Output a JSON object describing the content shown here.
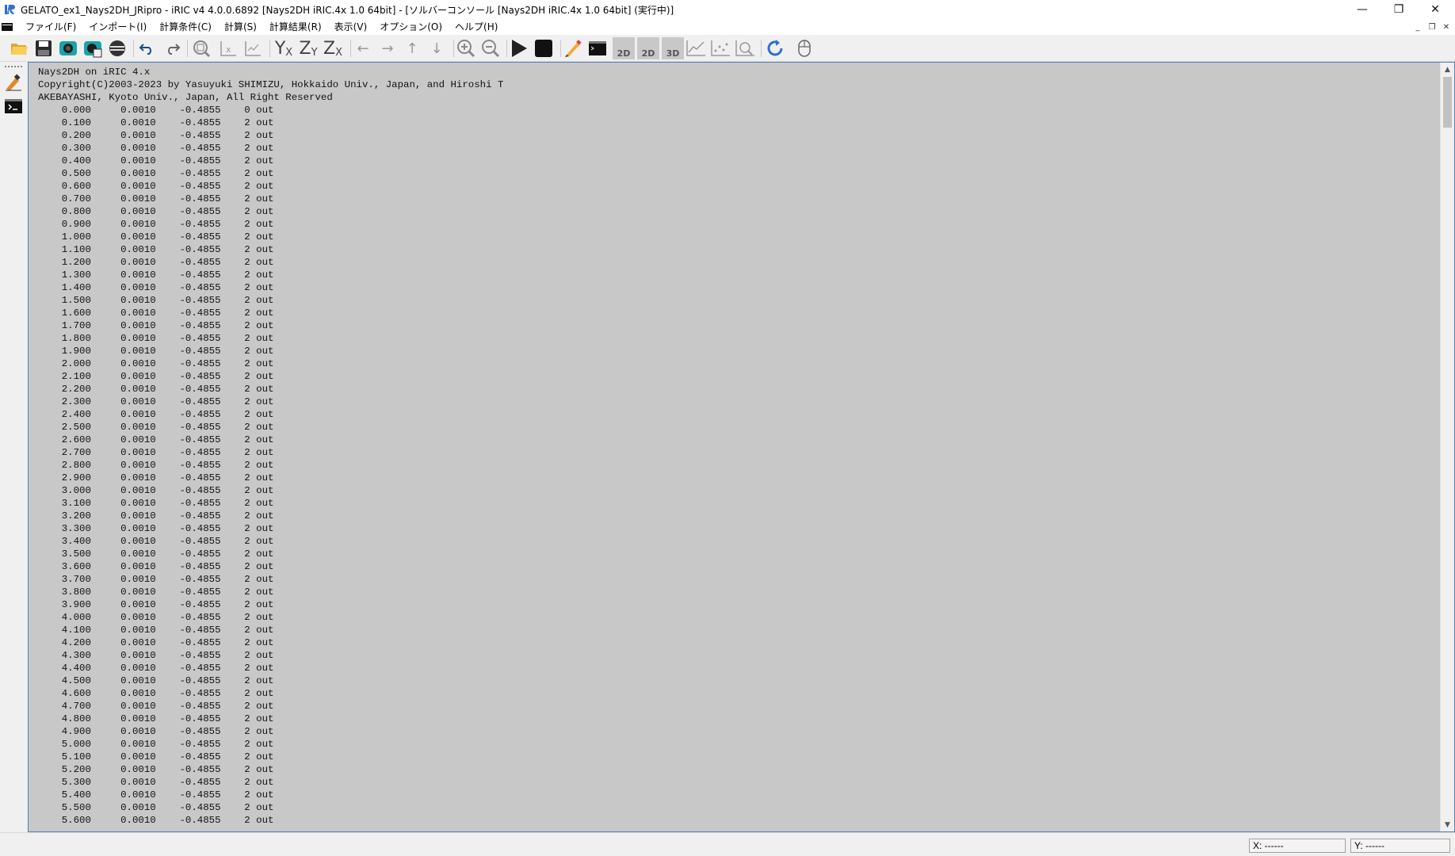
{
  "window": {
    "title": "GELATO_ex1_Nays2DH_JRipro - iRIC v4 4.0.0.6892 [Nays2DH iRIC.4x 1.0 64bit] - [ソルバーコンソール [Nays2DH iRIC.4x 1.0 64bit] (実行中)]",
    "controls": {
      "minimize": "—",
      "restore": "❐",
      "close": "✕"
    }
  },
  "menubar": {
    "items": [
      "ファイル(F)",
      "インポート(I)",
      "計算条件(C)",
      "計算(S)",
      "計算結果(R)",
      "表示(V)",
      "オプション(O)",
      "ヘルプ(H)"
    ],
    "mdi_controls": {
      "minimize": "_",
      "restore": "❐",
      "close": "✕"
    }
  },
  "toolbar": {
    "icons": [
      "open-folder-icon",
      "save-icon",
      "camera-icon",
      "camera-continuous-icon",
      "no-entry-icon",
      "undo-icon",
      "redo-icon",
      "zoom-fit-icon",
      "x-axis-icon",
      "xy-axis-icon",
      "yx-view-icon",
      "zy-view-icon",
      "zx-view-icon",
      "move-left-icon",
      "move-right-icon",
      "move-up-icon",
      "move-down-icon",
      "zoom-in-icon",
      "zoom-out-icon",
      "run-icon",
      "stop-icon",
      "pen-icon",
      "console-icon",
      "2d-view-icon",
      "2d-bird-view-icon",
      "3d-view-icon",
      "graph-icon",
      "scatter-graph-icon",
      "zoom-graph-icon",
      "refresh-icon",
      "mouse-icon"
    ],
    "labels": {
      "yx": "Y",
      "yx_sub": "X",
      "zy": "Z",
      "zy_sub": "Y",
      "zx": "Z",
      "zx_sub": "X",
      "twod": "2D",
      "twod2": "2D",
      "threed": "3D"
    }
  },
  "console": {
    "header": [
      "Nays2DH on iRIC 4.x",
      "Copyright(C)2003-2023 by Yasuyuki SHIMIZU, Hokkaido Univ., Japan, and Hiroshi T",
      "AKEBAYASHI, Kyoto Univ., Japan, All Right Reserved"
    ],
    "rows": [
      [
        "0.000",
        "0.0010",
        "-0.4855",
        "0",
        "out"
      ],
      [
        "0.100",
        "0.0010",
        "-0.4855",
        "2",
        "out"
      ],
      [
        "0.200",
        "0.0010",
        "-0.4855",
        "2",
        "out"
      ],
      [
        "0.300",
        "0.0010",
        "-0.4855",
        "2",
        "out"
      ],
      [
        "0.400",
        "0.0010",
        "-0.4855",
        "2",
        "out"
      ],
      [
        "0.500",
        "0.0010",
        "-0.4855",
        "2",
        "out"
      ],
      [
        "0.600",
        "0.0010",
        "-0.4855",
        "2",
        "out"
      ],
      [
        "0.700",
        "0.0010",
        "-0.4855",
        "2",
        "out"
      ],
      [
        "0.800",
        "0.0010",
        "-0.4855",
        "2",
        "out"
      ],
      [
        "0.900",
        "0.0010",
        "-0.4855",
        "2",
        "out"
      ],
      [
        "1.000",
        "0.0010",
        "-0.4855",
        "2",
        "out"
      ],
      [
        "1.100",
        "0.0010",
        "-0.4855",
        "2",
        "out"
      ],
      [
        "1.200",
        "0.0010",
        "-0.4855",
        "2",
        "out"
      ],
      [
        "1.300",
        "0.0010",
        "-0.4855",
        "2",
        "out"
      ],
      [
        "1.400",
        "0.0010",
        "-0.4855",
        "2",
        "out"
      ],
      [
        "1.500",
        "0.0010",
        "-0.4855",
        "2",
        "out"
      ],
      [
        "1.600",
        "0.0010",
        "-0.4855",
        "2",
        "out"
      ],
      [
        "1.700",
        "0.0010",
        "-0.4855",
        "2",
        "out"
      ],
      [
        "1.800",
        "0.0010",
        "-0.4855",
        "2",
        "out"
      ],
      [
        "1.900",
        "0.0010",
        "-0.4855",
        "2",
        "out"
      ],
      [
        "2.000",
        "0.0010",
        "-0.4855",
        "2",
        "out"
      ],
      [
        "2.100",
        "0.0010",
        "-0.4855",
        "2",
        "out"
      ],
      [
        "2.200",
        "0.0010",
        "-0.4855",
        "2",
        "out"
      ],
      [
        "2.300",
        "0.0010",
        "-0.4855",
        "2",
        "out"
      ],
      [
        "2.400",
        "0.0010",
        "-0.4855",
        "2",
        "out"
      ],
      [
        "2.500",
        "0.0010",
        "-0.4855",
        "2",
        "out"
      ],
      [
        "2.600",
        "0.0010",
        "-0.4855",
        "2",
        "out"
      ],
      [
        "2.700",
        "0.0010",
        "-0.4855",
        "2",
        "out"
      ],
      [
        "2.800",
        "0.0010",
        "-0.4855",
        "2",
        "out"
      ],
      [
        "2.900",
        "0.0010",
        "-0.4855",
        "2",
        "out"
      ],
      [
        "3.000",
        "0.0010",
        "-0.4855",
        "2",
        "out"
      ],
      [
        "3.100",
        "0.0010",
        "-0.4855",
        "2",
        "out"
      ],
      [
        "3.200",
        "0.0010",
        "-0.4855",
        "2",
        "out"
      ],
      [
        "3.300",
        "0.0010",
        "-0.4855",
        "2",
        "out"
      ],
      [
        "3.400",
        "0.0010",
        "-0.4855",
        "2",
        "out"
      ],
      [
        "3.500",
        "0.0010",
        "-0.4855",
        "2",
        "out"
      ],
      [
        "3.600",
        "0.0010",
        "-0.4855",
        "2",
        "out"
      ],
      [
        "3.700",
        "0.0010",
        "-0.4855",
        "2",
        "out"
      ],
      [
        "3.800",
        "0.0010",
        "-0.4855",
        "2",
        "out"
      ],
      [
        "3.900",
        "0.0010",
        "-0.4855",
        "2",
        "out"
      ],
      [
        "4.000",
        "0.0010",
        "-0.4855",
        "2",
        "out"
      ],
      [
        "4.100",
        "0.0010",
        "-0.4855",
        "2",
        "out"
      ],
      [
        "4.200",
        "0.0010",
        "-0.4855",
        "2",
        "out"
      ],
      [
        "4.300",
        "0.0010",
        "-0.4855",
        "2",
        "out"
      ],
      [
        "4.400",
        "0.0010",
        "-0.4855",
        "2",
        "out"
      ],
      [
        "4.500",
        "0.0010",
        "-0.4855",
        "2",
        "out"
      ],
      [
        "4.600",
        "0.0010",
        "-0.4855",
        "2",
        "out"
      ],
      [
        "4.700",
        "0.0010",
        "-0.4855",
        "2",
        "out"
      ],
      [
        "4.800",
        "0.0010",
        "-0.4855",
        "2",
        "out"
      ],
      [
        "4.900",
        "0.0010",
        "-0.4855",
        "2",
        "out"
      ],
      [
        "5.000",
        "0.0010",
        "-0.4855",
        "2",
        "out"
      ],
      [
        "5.100",
        "0.0010",
        "-0.4855",
        "2",
        "out"
      ],
      [
        "5.200",
        "0.0010",
        "-0.4855",
        "2",
        "out"
      ],
      [
        "5.300",
        "0.0010",
        "-0.4855",
        "2",
        "out"
      ],
      [
        "5.400",
        "0.0010",
        "-0.4855",
        "2",
        "out"
      ],
      [
        "5.500",
        "0.0010",
        "-0.4855",
        "2",
        "out"
      ],
      [
        "5.600",
        "0.0010",
        "-0.4855",
        "2",
        "out"
      ]
    ],
    "background_color": "#c8c8c8",
    "text_color": "#111111"
  },
  "statusbar": {
    "x_coord": "X: ------",
    "y_coord": "Y: ------"
  },
  "colors": {
    "accent": "#4f82b5",
    "icon_teal": "#1aa3a8",
    "folder": "#f2c14e",
    "refresh": "#2f6fd6"
  }
}
